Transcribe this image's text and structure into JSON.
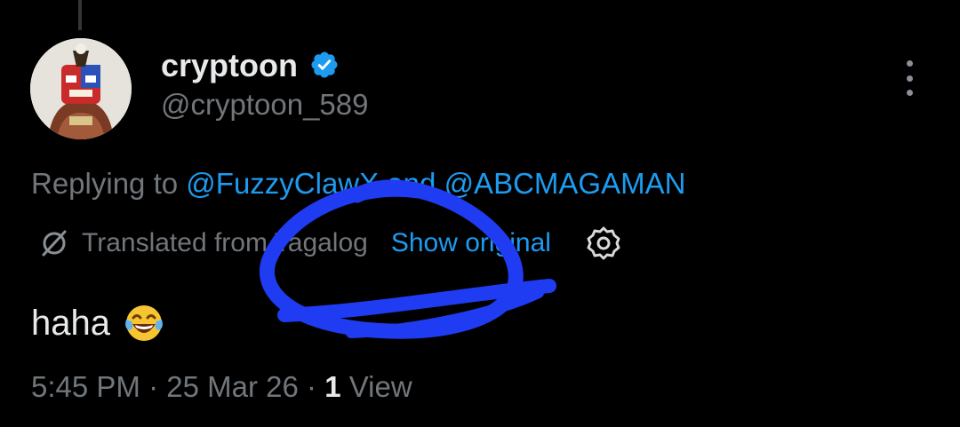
{
  "author": {
    "display_name": "cryptoon",
    "handle": "@cryptoon_589"
  },
  "reply": {
    "prefix": "Replying to",
    "mention_1": "@FuzzyClawX",
    "joiner": "and",
    "mention_2": "@ABCMAGAMAN"
  },
  "translation": {
    "label": "Translated from Tagalog",
    "show_original": "Show original"
  },
  "tweet": {
    "text": "haha",
    "emoji": "face-with-tears-of-joy"
  },
  "meta": {
    "time": "5:45 PM",
    "date": "25 Mar 26",
    "view_count": "1",
    "view_label": "View"
  },
  "colors": {
    "background": "#000000",
    "text": "#e7e9ea",
    "secondary": "#71767b",
    "link": "#1d9bf0",
    "scribble": "#1f3cf2"
  },
  "icons": [
    "verified-badge-icon",
    "more-icon",
    "translate-globe-icon",
    "gear-icon"
  ]
}
